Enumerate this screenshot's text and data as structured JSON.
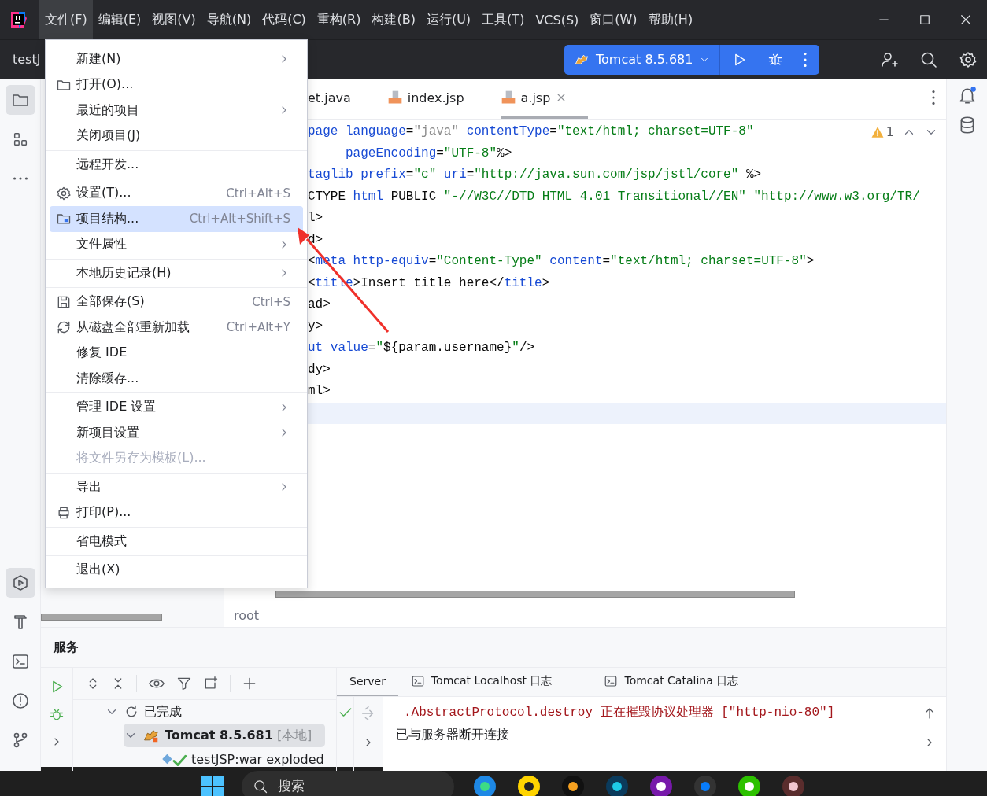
{
  "menu_bar": [
    {
      "label": "文件(F)",
      "selected": true
    },
    {
      "label": "编辑(E)",
      "selected": false
    },
    {
      "label": "视图(V)",
      "selected": false
    },
    {
      "label": "导航(N)",
      "selected": false
    },
    {
      "label": "代码(C)",
      "selected": false
    },
    {
      "label": "重构(R)",
      "selected": false
    },
    {
      "label": "构建(B)",
      "selected": false
    },
    {
      "label": "运行(U)",
      "selected": false
    },
    {
      "label": "工具(T)",
      "selected": false
    },
    {
      "label": "VCS(S)",
      "selected": false
    },
    {
      "label": "窗口(W)",
      "selected": false
    },
    {
      "label": "帮助(H)",
      "selected": false
    }
  ],
  "toolbar": {
    "project": "testJ",
    "run_config": "Tomcat 8.5.681"
  },
  "file_menu": [
    {
      "kind": "item",
      "label": "新建(N)",
      "submenu": true,
      "selected": false,
      "disabled": false
    },
    {
      "kind": "item",
      "label": "打开(O)...",
      "submenu": false,
      "selected": false,
      "disabled": false
    },
    {
      "kind": "item",
      "label": "最近的项目",
      "submenu": true,
      "selected": false,
      "disabled": false
    },
    {
      "kind": "item",
      "label": "关闭项目(J)",
      "submenu": false,
      "selected": false,
      "disabled": false
    },
    {
      "kind": "separator"
    },
    {
      "kind": "item",
      "label": "远程开发...",
      "submenu": false,
      "selected": false,
      "disabled": false
    },
    {
      "kind": "separator"
    },
    {
      "kind": "item",
      "label": "设置(T)...",
      "shortcut": "Ctrl+Alt+S",
      "submenu": false,
      "selected": false,
      "disabled": false
    },
    {
      "kind": "item",
      "label": "项目结构...",
      "shortcut": "Ctrl+Alt+Shift+S",
      "submenu": false,
      "selected": true,
      "disabled": false
    },
    {
      "kind": "item",
      "label": "文件属性",
      "submenu": true,
      "selected": false,
      "disabled": false
    },
    {
      "kind": "separator"
    },
    {
      "kind": "item",
      "label": "本地历史记录(H)",
      "submenu": true,
      "selected": false,
      "disabled": false
    },
    {
      "kind": "separator"
    },
    {
      "kind": "item",
      "label": "全部保存(S)",
      "shortcut": "Ctrl+S",
      "submenu": false,
      "selected": false,
      "disabled": false
    },
    {
      "kind": "item",
      "label": "从磁盘全部重新加载",
      "shortcut": "Ctrl+Alt+Y",
      "submenu": false,
      "selected": false,
      "disabled": false
    },
    {
      "kind": "item",
      "label": "修复 IDE",
      "submenu": false,
      "selected": false,
      "disabled": false
    },
    {
      "kind": "item",
      "label": "清除缓存...",
      "submenu": false,
      "selected": false,
      "disabled": false
    },
    {
      "kind": "separator"
    },
    {
      "kind": "item",
      "label": "管理 IDE 设置",
      "submenu": true,
      "selected": false,
      "disabled": false
    },
    {
      "kind": "item",
      "label": "新项目设置",
      "submenu": true,
      "selected": false,
      "disabled": false
    },
    {
      "kind": "item",
      "label": "将文件另存为模板(L)...",
      "submenu": false,
      "selected": false,
      "disabled": true
    },
    {
      "kind": "separator"
    },
    {
      "kind": "item",
      "label": "导出",
      "submenu": true,
      "selected": false,
      "disabled": false
    },
    {
      "kind": "item",
      "label": "打印(P)...",
      "submenu": false,
      "selected": false,
      "disabled": false
    },
    {
      "kind": "separator"
    },
    {
      "kind": "item",
      "label": "省电模式",
      "submenu": false,
      "selected": false,
      "disabled": false
    },
    {
      "kind": "separator"
    },
    {
      "kind": "item",
      "label": "退出(X)",
      "submenu": false,
      "selected": false,
      "disabled": false
    }
  ],
  "editor": {
    "tabs": [
      {
        "label": "et.java",
        "kind": "java",
        "selected": false
      },
      {
        "label": "index.jsp",
        "kind": "jsp",
        "selected": false
      },
      {
        "label": "a.jsp",
        "kind": "jsp",
        "selected": true
      }
    ],
    "warnings": "1",
    "lines": [
      {
        "current": false,
        "tokens": [
          {
            "text": "page",
            "kind": "kw"
          },
          {
            "text": " language",
            "kind": "kw"
          },
          {
            "text": "=",
            "kind": "plain"
          },
          {
            "text": "\"java\"",
            "kind": "dim"
          },
          {
            "text": " contentType",
            "kind": "kw"
          },
          {
            "text": "=",
            "kind": "plain"
          },
          {
            "text": "\"text/html; charset=UTF-8\"",
            "kind": "str"
          }
        ]
      },
      {
        "current": false,
        "tokens": [
          {
            "text": "     pageEncoding",
            "kind": "kw"
          },
          {
            "text": "=",
            "kind": "plain"
          },
          {
            "text": "\"UTF-8\"",
            "kind": "str"
          },
          {
            "text": "%>",
            "kind": "plain"
          }
        ]
      },
      {
        "current": false,
        "tokens": [
          {
            "text": "taglib",
            "kind": "kw"
          },
          {
            "text": " prefix",
            "kind": "kw"
          },
          {
            "text": "=",
            "kind": "plain"
          },
          {
            "text": "\"c\"",
            "kind": "str"
          },
          {
            "text": " uri",
            "kind": "kw"
          },
          {
            "text": "=",
            "kind": "plain"
          },
          {
            "text": "\"http://java.sun.com/jsp/jstl/core\"",
            "kind": "str"
          },
          {
            "text": " %>",
            "kind": "plain"
          }
        ]
      },
      {
        "current": false,
        "tokens": [
          {
            "text": "CTYPE",
            "kind": "plain"
          },
          {
            "text": " html",
            "kind": "kw"
          },
          {
            "text": " PUBLIC ",
            "kind": "plain"
          },
          {
            "text": "\"-//W3C//DTD HTML 4.01 Transitional//EN\" \"http://www.w3.org/TR/",
            "kind": "str"
          }
        ]
      },
      {
        "current": false,
        "tokens": [
          {
            "text": "l>",
            "kind": "plain"
          }
        ]
      },
      {
        "current": false,
        "tokens": [
          {
            "text": "d>",
            "kind": "plain"
          }
        ]
      },
      {
        "current": false,
        "tokens": [
          {
            "text": "<",
            "kind": "plain"
          },
          {
            "text": "meta",
            "kind": "kw"
          },
          {
            "text": " http-equiv",
            "kind": "kw"
          },
          {
            "text": "=",
            "kind": "plain"
          },
          {
            "text": "\"Content-Type\"",
            "kind": "str"
          },
          {
            "text": " content",
            "kind": "kw"
          },
          {
            "text": "=",
            "kind": "plain"
          },
          {
            "text": "\"text/html; charset=UTF-8\"",
            "kind": "str"
          },
          {
            "text": ">",
            "kind": "plain"
          }
        ]
      },
      {
        "current": false,
        "tokens": [
          {
            "text": "<",
            "kind": "plain"
          },
          {
            "text": "title",
            "kind": "kw"
          },
          {
            "text": ">Insert title here</",
            "kind": "plain"
          },
          {
            "text": "title",
            "kind": "kw"
          },
          {
            "text": ">",
            "kind": "plain"
          }
        ]
      },
      {
        "current": false,
        "tokens": [
          {
            "text": "ad>",
            "kind": "plain"
          }
        ]
      },
      {
        "current": false,
        "tokens": [
          {
            "text": "y>",
            "kind": "plain"
          }
        ]
      },
      {
        "current": false,
        "tokens": [
          {
            "text": "ut",
            "kind": "kw"
          },
          {
            "text": " value",
            "kind": "kw"
          },
          {
            "text": "=",
            "kind": "plain"
          },
          {
            "text": "\"",
            "kind": "str"
          },
          {
            "text": "${param.username}",
            "kind": "plain"
          },
          {
            "text": "\"",
            "kind": "str"
          },
          {
            "text": "/>",
            "kind": "plain"
          }
        ]
      },
      {
        "current": false,
        "tokens": [
          {
            "text": "dy>",
            "kind": "plain"
          }
        ]
      },
      {
        "current": false,
        "tokens": [
          {
            "text": "ml>",
            "kind": "plain"
          }
        ]
      },
      {
        "current": true
      }
    ],
    "breadcrumb": "root"
  },
  "services": {
    "title": "服务",
    "tree": [
      {
        "label": "已完成",
        "kind": "group",
        "selected": false,
        "expanded": true,
        "children": [
          {
            "label": "Tomcat 8.5.681",
            "tag": "[本地]",
            "kind": "server",
            "selected": true,
            "expanded": true,
            "children": [
              {
                "label": "testJSP:war exploded",
                "kind": "artifact",
                "selected": false
              }
            ]
          }
        ]
      }
    ],
    "tabs": [
      {
        "label": "Server",
        "kind": "plain",
        "selected": true
      },
      {
        "label": "Tomcat Localhost 日志",
        "kind": "console",
        "selected": false
      },
      {
        "label": "Tomcat Catalina 日志",
        "kind": "console",
        "selected": false
      }
    ],
    "log": [
      {
        "text": ".AbstractProtocol.destroy 正在摧毁协议处理器 [\"http-nio-80\"]",
        "kind": "error"
      },
      {
        "text": "已与服务器断开连接",
        "kind": "info"
      }
    ]
  },
  "taskbar": {
    "search_placeholder": "搜索"
  }
}
